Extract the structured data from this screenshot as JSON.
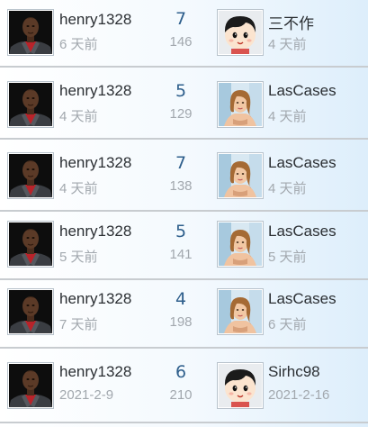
{
  "threads": [
    {
      "author": "henry1328",
      "author_time": "6 天前",
      "replies": "7",
      "views": "146",
      "last_user": "三不作",
      "last_time": "4 天前",
      "last_avatar": "cartoon-avatar"
    },
    {
      "author": "henry1328",
      "author_time": "4 天前",
      "replies": "5",
      "views": "129",
      "last_user": "LasCases",
      "last_time": "4 天前",
      "last_avatar": "photo-avatar"
    },
    {
      "author": "henry1328",
      "author_time": "4 天前",
      "replies": "7",
      "views": "138",
      "last_user": "LasCases",
      "last_time": "4 天前",
      "last_avatar": "photo-avatar"
    },
    {
      "author": "henry1328",
      "author_time": "5 天前",
      "replies": "5",
      "views": "141",
      "last_user": "LasCases",
      "last_time": "5 天前",
      "last_avatar": "photo-avatar"
    },
    {
      "author": "henry1328",
      "author_time": "7 天前",
      "replies": "4",
      "views": "198",
      "last_user": "LasCases",
      "last_time": "6 天前",
      "last_avatar": "photo-avatar"
    },
    {
      "author": "henry1328",
      "author_time": "2021-2-9",
      "replies": "6",
      "views": "210",
      "last_user": "Sirhc98",
      "last_time": "2021-2-16",
      "last_avatar": "cartoon-avatar"
    }
  ]
}
